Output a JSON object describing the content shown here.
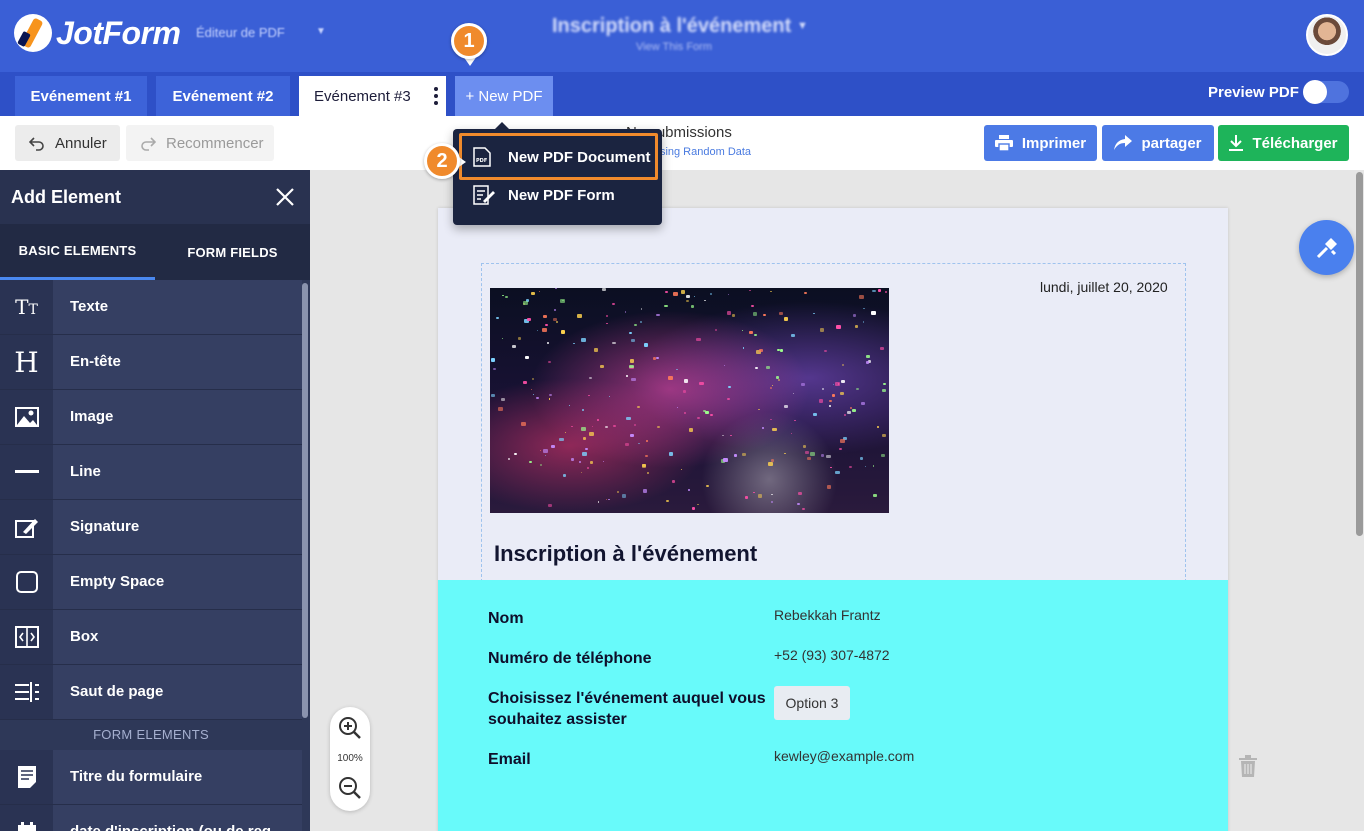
{
  "header": {
    "logo_text": "JotForm",
    "app_name": "Éditeur de PDF",
    "form_title": "Inscription à l'événement",
    "form_subtitle": "View This Form"
  },
  "tabs": {
    "items": [
      "Evénement #1",
      "Evénement #2",
      "Evénement #3"
    ],
    "active_index": 2,
    "new_pdf_label": "+ New PDF",
    "preview_label": "Preview PDF",
    "preview_enabled": true
  },
  "toolbar": {
    "undo_label": "Annuler",
    "redo_label": "Recommencer",
    "submissions_title": "No submissions",
    "submissions_sub": "Using Random Data",
    "print_label": "Imprimer",
    "share_label": "partager",
    "download_label": "Télécharger"
  },
  "dropdown": {
    "items": [
      {
        "label": "New PDF Document",
        "icon": "pdf-document-icon"
      },
      {
        "label": "New PDF Form",
        "icon": "pdf-form-icon"
      }
    ]
  },
  "steps": [
    "1",
    "2"
  ],
  "sidebar": {
    "title": "Add Element",
    "tabs": [
      "BASIC ELEMENTS",
      "FORM FIELDS"
    ],
    "items": [
      {
        "label": "Texte",
        "icon": "text-icon"
      },
      {
        "label": "En-tête",
        "icon": "heading-icon"
      },
      {
        "label": "Image",
        "icon": "image-icon"
      },
      {
        "label": "Line",
        "icon": "line-icon"
      },
      {
        "label": "Signature",
        "icon": "signature-icon"
      },
      {
        "label": "Empty Space",
        "icon": "empty-space-icon"
      },
      {
        "label": "Box",
        "icon": "box-icon"
      },
      {
        "label": "Saut de page",
        "icon": "page-break-icon"
      }
    ],
    "section_label": "FORM ELEMENTS",
    "form_items": [
      {
        "label": "Titre du formulaire",
        "icon": "form-title-icon"
      },
      {
        "label": "date d'inscription (ou de reg...",
        "icon": "calendar-icon"
      }
    ]
  },
  "document": {
    "date": "lundi, juillet 20, 2020",
    "heading": "Inscription à l'événement",
    "fields": [
      {
        "label": "Nom",
        "value": "Rebekkah Frantz"
      },
      {
        "label": "Numéro de téléphone",
        "value": "+52 (93) 307-4872"
      },
      {
        "label": "Choisissez l'événement auquel vous souhaitez assister",
        "value": "Option 3"
      },
      {
        "label": "Email",
        "value": "kewley@example.com"
      }
    ]
  },
  "zoom": {
    "level": "100%"
  },
  "colors": {
    "header_blue": "#3a5fd6",
    "accent_orange": "#f08a2c",
    "download_green": "#1eb45a",
    "form_cyan": "#68fafa",
    "sidebar_navy": "#2e3858"
  }
}
